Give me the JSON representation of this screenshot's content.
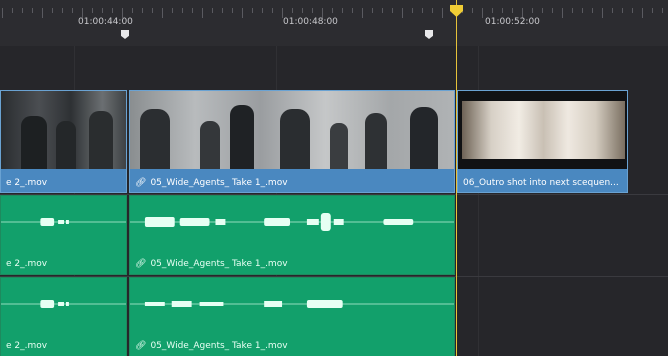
{
  "ruler": {
    "timecodes": [
      "01:00:44:00",
      "01:00:48:00",
      "01:00:52:00"
    ]
  },
  "video_track": {
    "clips": [
      {
        "label": "e 2_.mov",
        "linked": false
      },
      {
        "label": "05_Wide_Agents_ Take 1_.mov",
        "linked": true
      },
      {
        "label": "06_Outro shot into next scequen...",
        "linked": false
      }
    ]
  },
  "audio_track_1": {
    "clips": [
      {
        "label": "e 2_.mov",
        "linked": false
      },
      {
        "label": "05_Wide_Agents_ Take 1_.mov",
        "linked": true
      }
    ]
  },
  "audio_track_2": {
    "clips": [
      {
        "label": "e 2_.mov",
        "linked": false
      },
      {
        "label": "05_Wide_Agents_ Take 1_.mov",
        "linked": true
      }
    ]
  },
  "icons": {
    "link": "link-icon",
    "marker": "marker-icon",
    "playhead": "playhead-icon"
  },
  "colors": {
    "background": "#26262a",
    "video_clip": "#4a88c0",
    "audio_clip": "#12a06b",
    "playhead": "#f0cd35"
  }
}
